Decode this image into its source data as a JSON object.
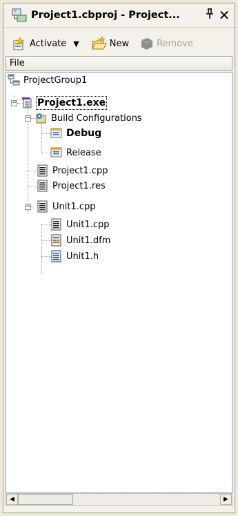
{
  "window": {
    "title": "Project1.cbproj - Project...",
    "pin_glyph": "ꟷ",
    "close_glyph": "✕"
  },
  "toolbar": {
    "activate_label": "Activate",
    "new_label": "New",
    "remove_label": "Remove"
  },
  "tree": {
    "column_header": "File",
    "root": "ProjectGroup1",
    "project": "Project1.exe",
    "build_configurations": "Build Configurations",
    "debug": "Debug",
    "release": "Release",
    "project_cpp": "Project1.cpp",
    "project_res": "Project1.res",
    "unit_cpp_parent": "Unit1.cpp",
    "unit_cpp": "Unit1.cpp",
    "unit_dfm": "Unit1.dfm",
    "unit_h": "Unit1.h"
  },
  "icons": {
    "group": "project-group-icon",
    "project": "project-exe-icon",
    "build_config": "build-configurations-icon",
    "config": "config-icon",
    "cpp": "cpp-file-icon",
    "dfm": "form-file-icon",
    "header": "header-file-icon"
  },
  "colors": {
    "panel_bg": "#ece9d8",
    "tree_bg": "#ffffff",
    "accent_blue": "#316ac5",
    "disabled_text": "#a3a196"
  }
}
